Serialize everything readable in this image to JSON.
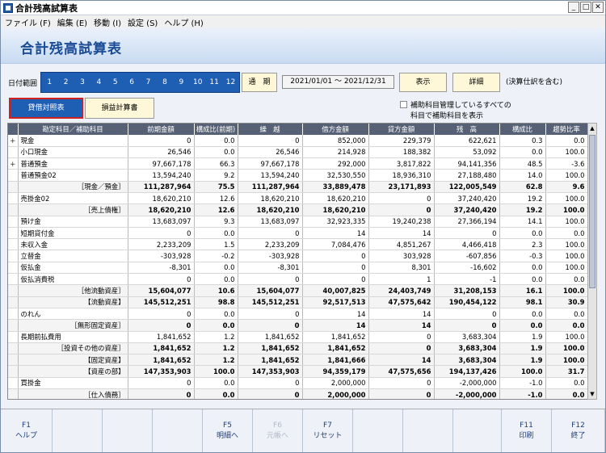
{
  "window": {
    "title": "合計残高試算表"
  },
  "menu": [
    "ファイル (F)",
    "編集 (E)",
    "移動 (I)",
    "設定 (S)",
    "ヘルプ (H)"
  ],
  "header": {
    "title": "合計残高試算表"
  },
  "datebar": {
    "label": "日付範囲",
    "months": [
      "1",
      "2",
      "3",
      "4",
      "5",
      "6",
      "7",
      "8",
      "9",
      "10",
      "11",
      "12"
    ],
    "period_btn": "通　期",
    "range": "2021/01/01 ～ 2021/12/31",
    "show_btn": "表示",
    "detail_btn": "詳細",
    "note": "(決算仕訳を含む)"
  },
  "tabs": {
    "balance_sheet": "貸借対照表",
    "income_statement": "損益計算書"
  },
  "options": {
    "opt1": "補助科目管理しているすべての",
    "opt2": "科目で補助科目を表示"
  },
  "table": {
    "headers": [
      "",
      "勘定科目／補助科目",
      "前期金額",
      "構成比(前期)",
      "繰　越",
      "借方金額",
      "貸方金額",
      "残　高",
      "構成比",
      "趨勢比率"
    ],
    "rows": [
      {
        "e": "+",
        "n": "現金",
        "s": false,
        "v": [
          "0",
          "0.0",
          "0",
          "852,000",
          "229,379",
          "622,621",
          "0.3",
          "0.0"
        ]
      },
      {
        "e": "",
        "n": "小口現金",
        "s": false,
        "v": [
          "26,546",
          "0.0",
          "26,546",
          "214,928",
          "188,382",
          "53,092",
          "0.0",
          "100.0"
        ]
      },
      {
        "e": "+",
        "n": "普通預金",
        "s": false,
        "v": [
          "97,667,178",
          "66.3",
          "97,667,178",
          "292,000",
          "3,817,822",
          "94,141,356",
          "48.5",
          "-3.6"
        ]
      },
      {
        "e": "",
        "n": "普通預金02",
        "s": false,
        "v": [
          "13,594,240",
          "9.2",
          "13,594,240",
          "32,530,550",
          "18,936,310",
          "27,188,480",
          "14.0",
          "100.0"
        ]
      },
      {
        "e": "",
        "n": "［現金／預金］",
        "s": true,
        "v": [
          "111,287,964",
          "75.5",
          "111,287,964",
          "33,889,478",
          "23,171,893",
          "122,005,549",
          "62.8",
          "9.6"
        ]
      },
      {
        "e": "",
        "n": "売掛金02",
        "s": false,
        "v": [
          "18,620,210",
          "12.6",
          "18,620,210",
          "18,620,210",
          "0",
          "37,240,420",
          "19.2",
          "100.0"
        ]
      },
      {
        "e": "",
        "n": "［売上債権］",
        "s": true,
        "v": [
          "18,620,210",
          "12.6",
          "18,620,210",
          "18,620,210",
          "0",
          "37,240,420",
          "19.2",
          "100.0"
        ]
      },
      {
        "e": "",
        "n": "預け金",
        "s": false,
        "v": [
          "13,683,097",
          "9.3",
          "13,683,097",
          "32,923,335",
          "19,240,238",
          "27,366,194",
          "14.1",
          "100.0"
        ]
      },
      {
        "e": "",
        "n": "短期貸付金",
        "s": false,
        "v": [
          "0",
          "0.0",
          "0",
          "14",
          "14",
          "0",
          "0.0",
          "0.0"
        ]
      },
      {
        "e": "",
        "n": "未収入金",
        "s": false,
        "v": [
          "2,233,209",
          "1.5",
          "2,233,209",
          "7,084,476",
          "4,851,267",
          "4,466,418",
          "2.3",
          "100.0"
        ]
      },
      {
        "e": "",
        "n": "立替金",
        "s": false,
        "v": [
          "-303,928",
          "-0.2",
          "-303,928",
          "0",
          "303,928",
          "-607,856",
          "-0.3",
          "100.0"
        ]
      },
      {
        "e": "",
        "n": "仮払金",
        "s": false,
        "v": [
          "-8,301",
          "0.0",
          "-8,301",
          "0",
          "8,301",
          "-16,602",
          "0.0",
          "100.0"
        ]
      },
      {
        "e": "",
        "n": "仮払消費税",
        "s": false,
        "v": [
          "0",
          "0.0",
          "0",
          "0",
          "1",
          "-1",
          "0.0",
          "0.0"
        ]
      },
      {
        "e": "",
        "n": "［他流動資産］",
        "s": true,
        "v": [
          "15,604,077",
          "10.6",
          "15,604,077",
          "40,007,825",
          "24,403,749",
          "31,208,153",
          "16.1",
          "100.0"
        ]
      },
      {
        "e": "",
        "n": "【流動資産】",
        "s": true,
        "v": [
          "145,512,251",
          "98.8",
          "145,512,251",
          "92,517,513",
          "47,575,642",
          "190,454,122",
          "98.1",
          "30.9"
        ]
      },
      {
        "e": "",
        "n": "のれん",
        "s": false,
        "v": [
          "0",
          "0.0",
          "0",
          "14",
          "14",
          "0",
          "0.0",
          "0.0"
        ]
      },
      {
        "e": "",
        "n": "［無形固定資産］",
        "s": true,
        "v": [
          "0",
          "0.0",
          "0",
          "14",
          "14",
          "0",
          "0.0",
          "0.0"
        ]
      },
      {
        "e": "",
        "n": "長期前払費用",
        "s": false,
        "v": [
          "1,841,652",
          "1.2",
          "1,841,652",
          "1,841,652",
          "0",
          "3,683,304",
          "1.9",
          "100.0"
        ]
      },
      {
        "e": "",
        "n": "［投資その他の資産］",
        "s": true,
        "v": [
          "1,841,652",
          "1.2",
          "1,841,652",
          "1,841,652",
          "0",
          "3,683,304",
          "1.9",
          "100.0"
        ]
      },
      {
        "e": "",
        "n": "【固定資産】",
        "s": true,
        "v": [
          "1,841,652",
          "1.2",
          "1,841,652",
          "1,841,666",
          "14",
          "3,683,304",
          "1.9",
          "100.0"
        ]
      },
      {
        "e": "",
        "n": "【資産の部】",
        "s": true,
        "v": [
          "147,353,903",
          "100.0",
          "147,353,903",
          "94,359,179",
          "47,575,656",
          "194,137,426",
          "100.0",
          "31.7"
        ]
      },
      {
        "e": "",
        "n": "買掛金",
        "s": false,
        "v": [
          "0",
          "0.0",
          "0",
          "2,000,000",
          "0",
          "-2,000,000",
          "-1.0",
          "0.0"
        ]
      },
      {
        "e": "",
        "n": "［仕入債務］",
        "s": true,
        "v": [
          "0",
          "0.0",
          "0",
          "2,000,000",
          "0",
          "-2,000,000",
          "-1.0",
          "0.0"
        ]
      }
    ]
  },
  "fkeys": [
    {
      "k": "F1",
      "l": "ヘルプ",
      "w": 64,
      "d": false
    },
    {
      "k": "",
      "l": "",
      "w": 62,
      "d": false
    },
    {
      "k": "",
      "l": "",
      "w": 62,
      "d": false
    },
    {
      "k": "",
      "l": "",
      "w": 62,
      "d": false
    },
    {
      "k": "F5",
      "l": "明細へ",
      "w": 62,
      "d": false
    },
    {
      "k": "F6",
      "l": "元帳へ",
      "w": 62,
      "d": false
    },
    {
      "k": "F7",
      "l": "リセット",
      "w": 62,
      "d": false
    },
    {
      "k": "",
      "l": "",
      "w": 62,
      "d": false
    },
    {
      "k": "",
      "l": "",
      "w": 62,
      "d": false
    },
    {
      "k": "",
      "l": "",
      "w": 60,
      "d": false
    },
    {
      "k": "F11",
      "l": "印刷",
      "w": 62,
      "d": false
    },
    {
      "k": "F12",
      "l": "終了",
      "w": 66,
      "d": false
    }
  ]
}
